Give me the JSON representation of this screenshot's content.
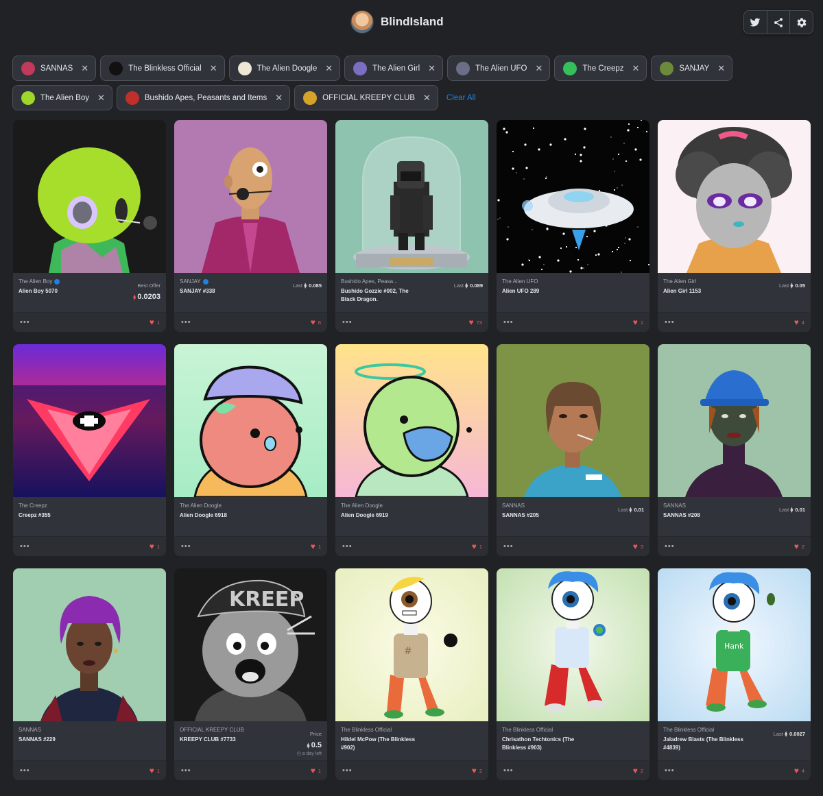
{
  "header": {
    "brand_name": "BlindIsland",
    "avatar_icon": "profile-avatar",
    "social": [
      {
        "name": "twitter-icon"
      },
      {
        "name": "share-icon"
      },
      {
        "name": "gear-icon"
      }
    ]
  },
  "filters": {
    "chips": [
      {
        "label": "SANNAS",
        "thumb_color": "#c23a5b"
      },
      {
        "label": "The Blinkless Official",
        "thumb_color": "#111111"
      },
      {
        "label": "The Alien Doogle",
        "thumb_color": "#efe7d5"
      },
      {
        "label": "The Alien Girl",
        "thumb_color": "#7a6ec2"
      },
      {
        "label": "The Alien UFO",
        "thumb_color": "#6a6e86"
      },
      {
        "label": "The Creepz",
        "thumb_color": "#34c05a"
      },
      {
        "label": "SANJAY",
        "thumb_color": "#6d8a3a"
      },
      {
        "label": "The Alien Boy",
        "thumb_color": "#9fd62a"
      },
      {
        "label": "Bushido Apes, Peasants and Items",
        "thumb_color": "#c0302a"
      },
      {
        "label": "OFFICIAL KREEPY CLUB",
        "thumb_color": "#d6a32a"
      }
    ],
    "clear_all": "Clear All"
  },
  "cards": [
    {
      "collection": "The Alien Boy",
      "verified": true,
      "name": "Alien Boy 5070",
      "price_label": "Best Offer",
      "price": "0.0203",
      "price_style": "big-pink",
      "likes": "1"
    },
    {
      "collection": "SANJAY",
      "verified": true,
      "name": "SANJAY #338",
      "price_label": "Last",
      "price": "0.085",
      "price_style": "small",
      "likes": "6"
    },
    {
      "collection": "Bushido Apes, Peasa...",
      "verified": false,
      "name": "Bushido Gozzie #002, The Black Dragon.",
      "price_label": "Last",
      "price": "0.089",
      "price_style": "small",
      "likes": "73"
    },
    {
      "collection": "The Alien UFO",
      "verified": false,
      "name": "Alien UFO 289",
      "price_label": "",
      "price": "",
      "price_style": "none",
      "likes": "1"
    },
    {
      "collection": "The Alien Girl",
      "verified": false,
      "name": "Alien Girl 1153",
      "price_label": "Last",
      "price": "0.05",
      "price_style": "small",
      "likes": "4"
    },
    {
      "collection": "The Creepz",
      "verified": false,
      "name": "Creepz #355",
      "price_label": "",
      "price": "",
      "price_style": "none",
      "likes": "1"
    },
    {
      "collection": "The Alien Doogle",
      "verified": false,
      "name": "Alien Doogle 6918",
      "price_label": "",
      "price": "",
      "price_style": "none",
      "likes": "1"
    },
    {
      "collection": "The Alien Doogle",
      "verified": false,
      "name": "Alien Doogle 6919",
      "price_label": "",
      "price": "",
      "price_style": "none",
      "likes": "1"
    },
    {
      "collection": "SANNAS",
      "verified": false,
      "name": "SANNAS #205",
      "price_label": "Last",
      "price": "0.01",
      "price_style": "small",
      "likes": "3"
    },
    {
      "collection": "SANNAS",
      "verified": false,
      "name": "SANNAS #208",
      "price_label": "Last",
      "price": "0.01",
      "price_style": "small",
      "likes": "2"
    },
    {
      "collection": "SANNAS",
      "verified": false,
      "name": "SANNAS #229",
      "price_label": "",
      "price": "",
      "price_style": "none",
      "likes": "1"
    },
    {
      "collection": "OFFICIAL KREEPY CLUB",
      "verified": false,
      "name": "KREEPY CLUB #7733",
      "price_label": "Price",
      "price": "0.5",
      "price_style": "big",
      "note": "a day left",
      "likes": "1"
    },
    {
      "collection": "The Blinkless Official",
      "verified": false,
      "name": "Hildel McPow (The Blinkless #902)",
      "price_label": "",
      "price": "",
      "price_style": "none",
      "likes": "2"
    },
    {
      "collection": "The Blinkless Official",
      "verified": false,
      "name": "Chrisathon Techtonics (The Blinkless #903)",
      "price_label": "",
      "price": "",
      "price_style": "none",
      "likes": "2"
    },
    {
      "collection": "The Blinkless Official",
      "verified": false,
      "name": "Jaladrew Blasts (The Blinkless #4839)",
      "price_label": "Last",
      "price": "0.0027",
      "price_style": "small",
      "likes": "4"
    }
  ],
  "card_labels": {
    "more": "•••"
  }
}
